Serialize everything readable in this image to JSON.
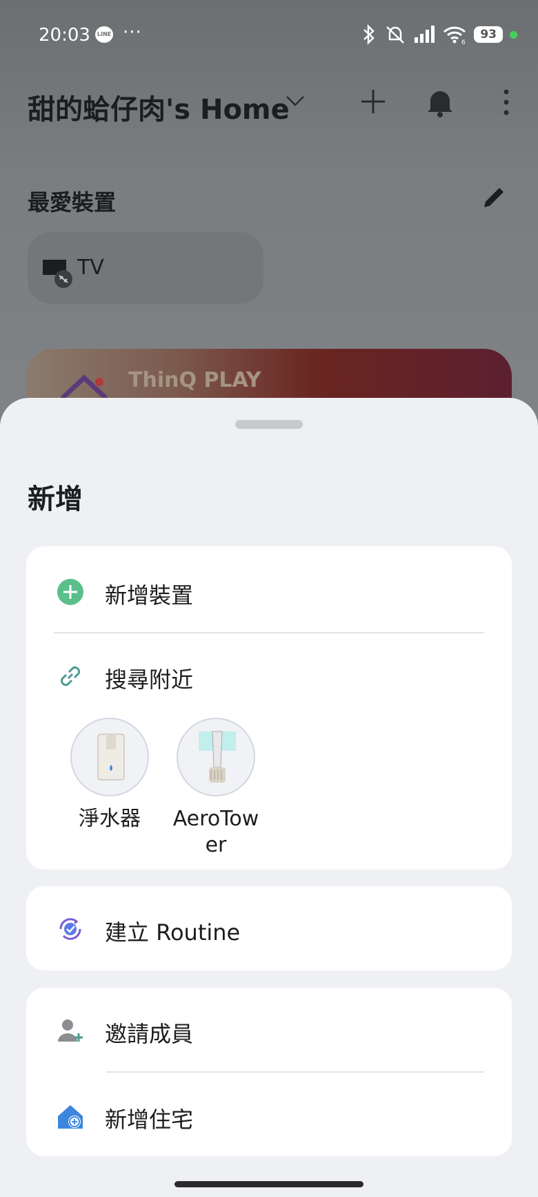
{
  "status_bar": {
    "time": "20:03",
    "line_app": "LINE",
    "more": "···",
    "battery": "93",
    "wifi_sub": "6"
  },
  "header": {
    "home_title": "甜的蛤仔肉's Home",
    "icons": [
      "chevron-down-icon",
      "plus-icon",
      "bell-icon",
      "kebab-menu-icon"
    ]
  },
  "favorites": {
    "title": "最愛裝置",
    "edit_icon": "pencil-icon",
    "devices": [
      {
        "label": "TV",
        "icon": "tv-disconnected-icon"
      }
    ]
  },
  "banner": {
    "title": "ThinQ PLAY"
  },
  "sheet": {
    "title": "新增",
    "add_device": {
      "label": "新增裝置",
      "icon": "plus-circle-icon",
      "color": "#5bbf8b"
    },
    "search_nearby": {
      "label": "搜尋附近",
      "icon": "link-icon",
      "color": "#4b9a93"
    },
    "nearby_devices": [
      {
        "label": "淨水器",
        "icon": "water-purifier-icon"
      },
      {
        "label": "AeroTower",
        "icon": "aerotower-icon"
      }
    ],
    "create_routine": {
      "label": "建立 Routine",
      "icon": "routine-icon",
      "color": "#7a5bd6"
    },
    "invite_member": {
      "label": "邀請成員",
      "icon": "add-person-icon"
    },
    "add_home": {
      "label": "新增住宅",
      "icon": "add-home-icon",
      "color": "#3d86e0"
    }
  },
  "colors": {
    "sheet_bg": "#eef0f3",
    "card_bg": "#ffffff"
  }
}
